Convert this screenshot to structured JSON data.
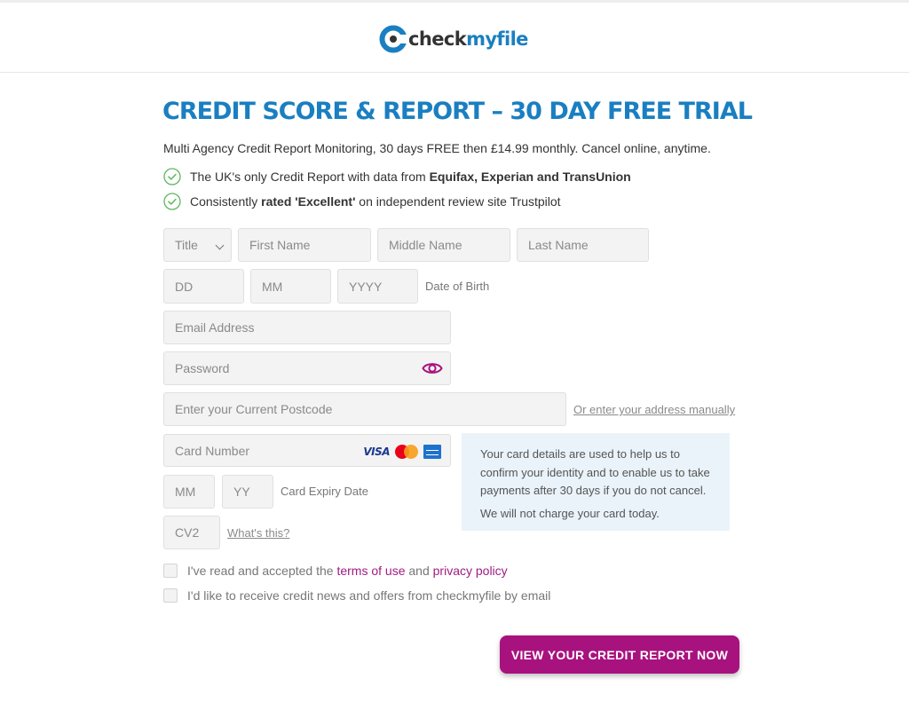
{
  "header": {
    "logo_part1": "check",
    "logo_part2": "myfile"
  },
  "hero": {
    "title": "CREDIT SCORE & REPORT – 30 DAY FREE TRIAL",
    "subtitle": "Multi Agency Credit Report Monitoring, 30 days FREE then £14.99 monthly. Cancel online, anytime.",
    "bullets": [
      {
        "pre": "The UK's only Credit Report with data from ",
        "bold": "Equifax, Experian and TransUnion",
        "post": ""
      },
      {
        "pre": "Consistently ",
        "bold": "rated 'Excellent'",
        "post": " on independent review site Trustpilot"
      }
    ]
  },
  "form": {
    "title_select": "Title",
    "first_name": "First Name",
    "middle_name": "Middle Name",
    "last_name": "Last Name",
    "dob_dd": "DD",
    "dob_mm": "MM",
    "dob_yyyy": "YYYY",
    "dob_label": "Date of Birth",
    "email": "Email Address",
    "password": "Password",
    "postcode": "Enter your Current Postcode",
    "manual_address_link": "Or enter your address manually",
    "card_number": "Card Number",
    "card_brand_visa": "VISA",
    "expiry_mm": "MM",
    "expiry_yy": "YY",
    "expiry_label": "Card Expiry Date",
    "cv2": "CV2",
    "whats_this_link": "What's this?"
  },
  "info_box": {
    "text1": "Your card details are used to help us to confirm your identity and to enable us to take payments after 30 days if you do not cancel.",
    "text2": "We will not charge your card today."
  },
  "consent": {
    "terms_pre": "I've read and accepted the ",
    "terms_link": "terms of use",
    "terms_and": " and ",
    "privacy_link": "privacy policy",
    "marketing": "I'd like to receive credit news and offers from checkmyfile by email"
  },
  "cta": {
    "label": "VIEW YOUR CREDIT REPORT NOW"
  },
  "colors": {
    "brand_blue": "#1a7fc1",
    "brand_magenta": "#a8127f",
    "check_green": "#5cb85c"
  }
}
